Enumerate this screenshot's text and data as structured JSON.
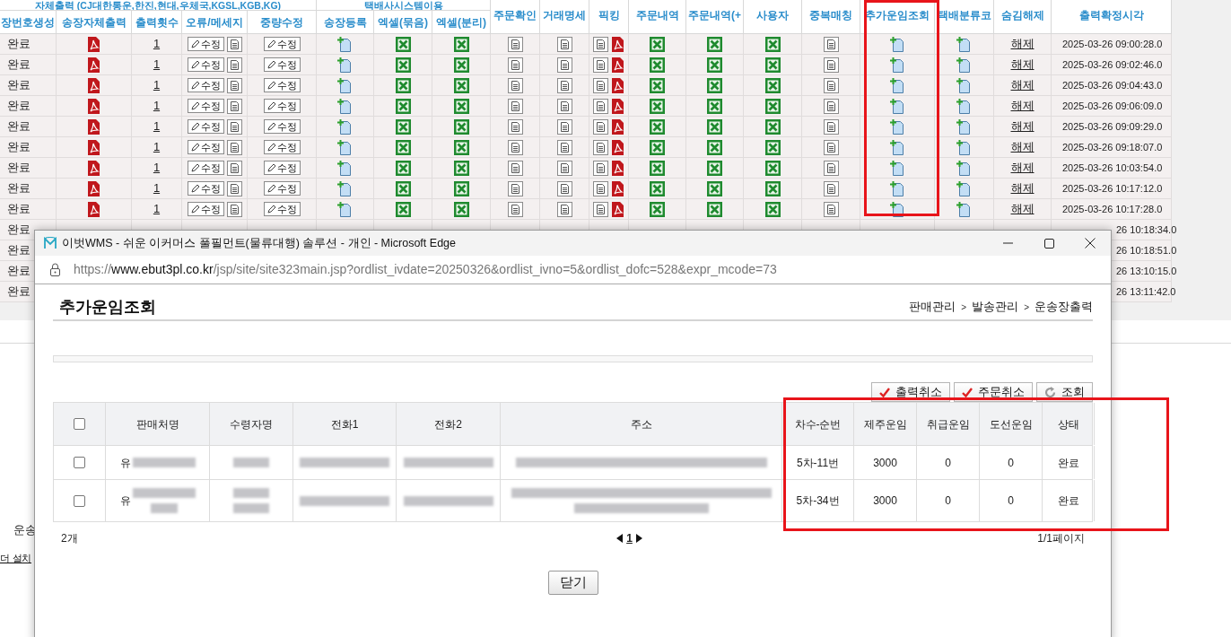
{
  "page": {
    "groups": [
      {
        "label": "자체출력 (CJ대한통운,한진,현대,우체국,KGSL,KGB,KG)"
      },
      {
        "label": "택배사시스템이용"
      }
    ],
    "columns": [
      {
        "label": "장번호생성",
        "kind": "status"
      },
      {
        "label": "송장자체출력",
        "kind": "pdf"
      },
      {
        "label": "출력횟수",
        "kind": "count"
      },
      {
        "label": "오류/메세지",
        "kind": "edit_doc"
      },
      {
        "label": "중량수정",
        "kind": "edit"
      },
      {
        "label": "송장등록",
        "kind": "add"
      },
      {
        "label": "엑셀(묶음)",
        "kind": "excel"
      },
      {
        "label": "엑셀(분리)",
        "kind": "excel"
      },
      {
        "label": "주문확인",
        "kind": "doc"
      },
      {
        "label": "거래명세",
        "kind": "doc"
      },
      {
        "label": "픽킹",
        "kind": "doc_pdf"
      },
      {
        "label": "주문내역",
        "kind": "excel"
      },
      {
        "label": "주문내역(+",
        "kind": "excel"
      },
      {
        "label": "사용자",
        "kind": "excel"
      },
      {
        "label": "중복매칭",
        "kind": "doc"
      },
      {
        "label": "추가운임조회",
        "kind": "add"
      },
      {
        "label": "택배분류코",
        "kind": "add"
      },
      {
        "label": "숨김해제",
        "kind": "unhide"
      },
      {
        "label": "출력확정시각",
        "kind": "time"
      }
    ],
    "rows": [
      {
        "kind": "full",
        "status": "완료",
        "count": "1",
        "edit_error": "수정",
        "edit_weight": "수정",
        "unhide": "해제",
        "time": "2025-03-26 09:00:28.0"
      },
      {
        "kind": "full",
        "status": "완료",
        "count": "1",
        "edit_error": "수정",
        "edit_weight": "수정",
        "unhide": "해제",
        "time": "2025-03-26 09:02:46.0"
      },
      {
        "kind": "full",
        "status": "완료",
        "count": "1",
        "edit_error": "수정",
        "edit_weight": "수정",
        "unhide": "해제",
        "time": "2025-03-26 09:04:43.0"
      },
      {
        "kind": "full",
        "status": "완료",
        "count": "1",
        "edit_error": "수정",
        "edit_weight": "수정",
        "unhide": "해제",
        "time": "2025-03-26 09:06:09.0"
      },
      {
        "kind": "full",
        "status": "완료",
        "count": "1",
        "edit_error": "수정",
        "edit_weight": "수정",
        "unhide": "해제",
        "time": "2025-03-26 09:09:29.0"
      },
      {
        "kind": "full",
        "status": "완료",
        "count": "1",
        "edit_error": "수정",
        "edit_weight": "수정",
        "unhide": "해제",
        "time": "2025-03-26 09:18:07.0"
      },
      {
        "kind": "full",
        "status": "완료",
        "count": "1",
        "edit_error": "수정",
        "edit_weight": "수정",
        "unhide": "해제",
        "time": "2025-03-26 10:03:54.0"
      },
      {
        "kind": "full",
        "status": "완료",
        "count": "1",
        "edit_error": "수정",
        "edit_weight": "수정",
        "unhide": "해제",
        "time": "2025-03-26 10:17:12.0"
      },
      {
        "kind": "full",
        "status": "완료",
        "count": "1",
        "edit_error": "수정",
        "edit_weight": "수정",
        "unhide": "해제",
        "time": "2025-03-26 10:17:28.0"
      },
      {
        "kind": "covered",
        "status": "완료",
        "time": "26 10:18:34.0"
      },
      {
        "kind": "covered",
        "status": "완료",
        "time": "26 10:18:51.0"
      },
      {
        "kind": "covered",
        "status": "완료",
        "time": "26 13:10:15.0"
      },
      {
        "kind": "covered",
        "status": "완료",
        "time": "26 13:11:42.0"
      }
    ],
    "below_texts": [
      {
        "text": "운송",
        "kind": "plain"
      },
      {
        "text": "더 설치",
        "kind": "link"
      }
    ]
  },
  "popup": {
    "window_title": "이벗WMS - 쉬운 이커머스 풀필먼트(물류대행) 솔루션 - 개인 - Microsoft Edge",
    "url": {
      "scheme": "https://",
      "host": "www.ebut3pl.co.kr",
      "path": "/jsp/site/site323main.jsp?ordlist_ivdate=20250326&ordlist_ivno=5&ordlist_dofc=528&expr_mcode=73"
    },
    "title": "추가운임조회",
    "breadcrumb": [
      "판매관리",
      "발송관리",
      "운송장출력"
    ],
    "breadcrumb_separator": ">",
    "actions": [
      {
        "label": "출력취소",
        "kind": "check"
      },
      {
        "label": "주문취소",
        "kind": "check"
      },
      {
        "label": "조회",
        "kind": "refresh"
      }
    ],
    "table": {
      "select_all_checked": false,
      "columns": [
        "판매처명",
        "수령자명",
        "전화1",
        "전화2",
        "주소",
        "차수-순번",
        "제주운임",
        "취급운임",
        "도선운임",
        "상태"
      ],
      "rows": [
        {
          "checked": false,
          "seller": "유",
          "round_seq": "5차-11번",
          "jeju_fee": "3000",
          "handling_fee": "0",
          "island_fee": "0",
          "status": "완료"
        },
        {
          "checked": false,
          "seller": "유",
          "round_seq": "5차-34번",
          "jeju_fee": "3000",
          "handling_fee": "0",
          "island_fee": "0",
          "status": "완료"
        }
      ]
    },
    "count": "2개",
    "current_page": "1",
    "page_info": "1/1페이지",
    "close_label": "닫기"
  }
}
